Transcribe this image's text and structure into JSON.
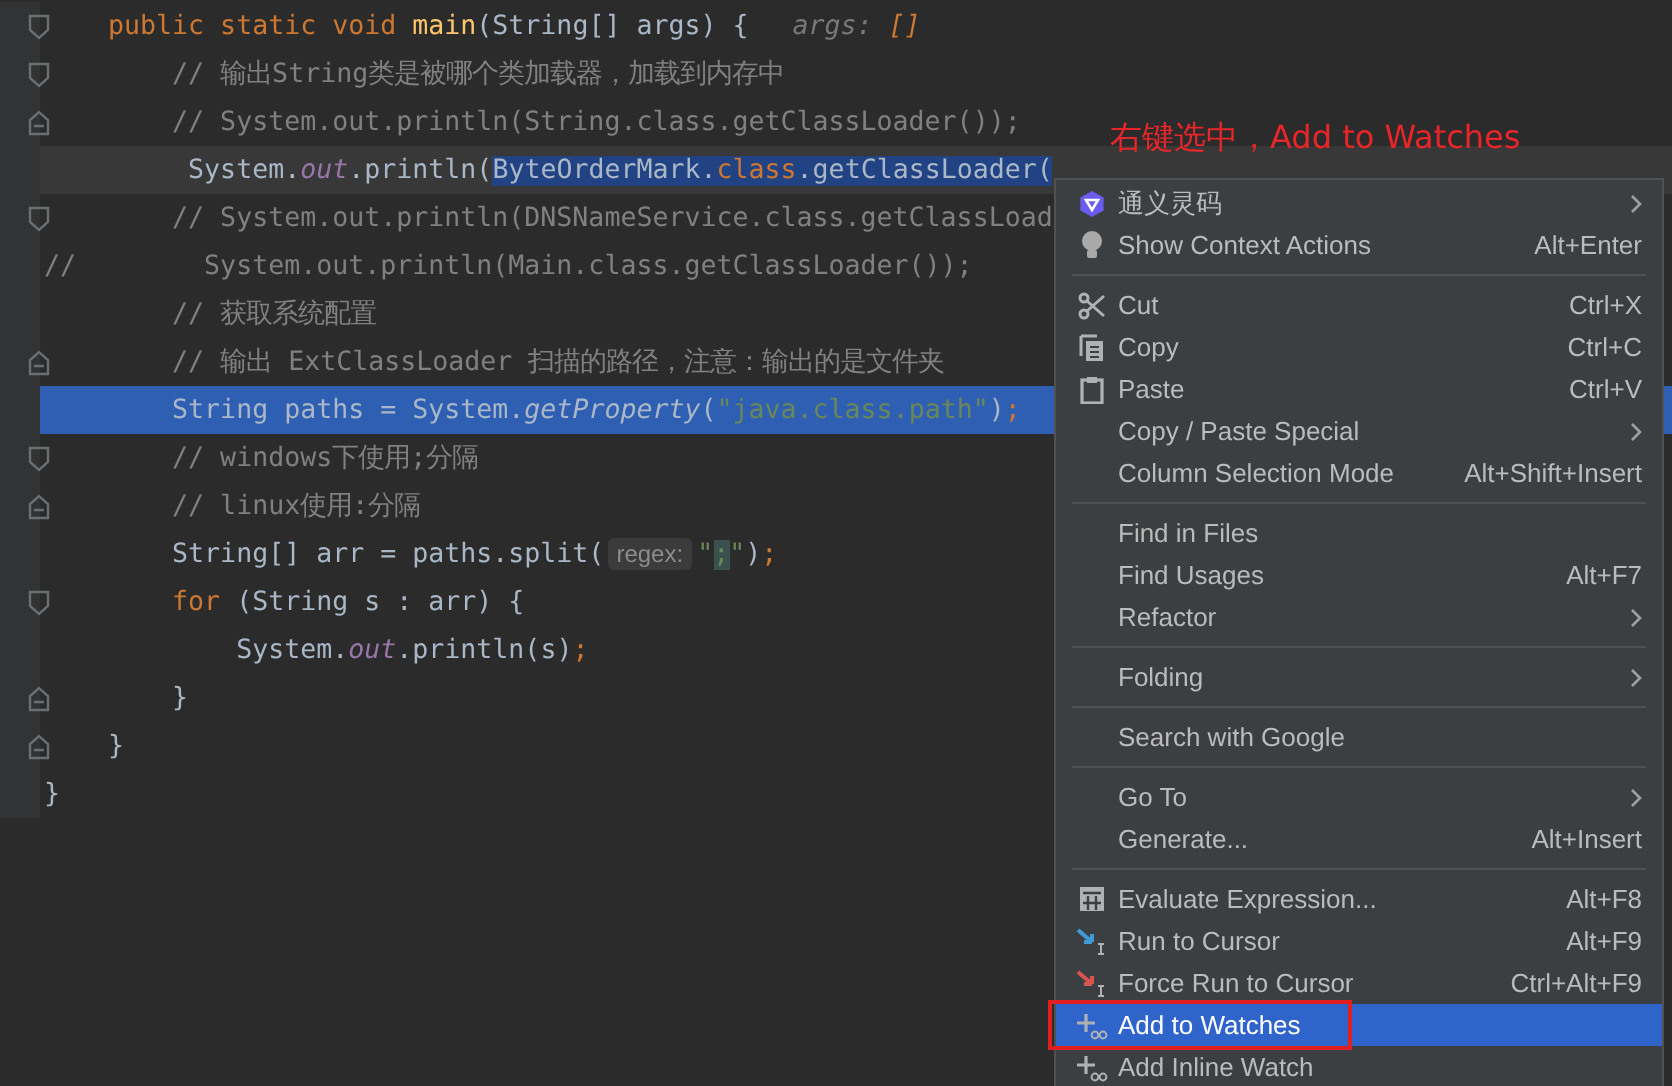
{
  "editor": {
    "lines": [
      {
        "fold_start": true,
        "fold_end": false,
        "current": false,
        "selected": false,
        "tokens": [
          {
            "t": "    public static void ",
            "kind": "kw"
          },
          {
            "t": "main",
            "kind": "decl"
          },
          {
            "t": "(String[] args) {",
            "kind": "plain"
          },
          {
            "t": "args: ",
            "kind": "debug-name"
          },
          {
            "t": "[]",
            "kind": "debug-value"
          }
        ]
      },
      {
        "fold_start": true,
        "fold_end": false,
        "current": false,
        "selected": false,
        "tokens": [
          {
            "t": "        // 输出String类是被哪个类加载器，加载到内存中",
            "kind": "comment"
          }
        ]
      },
      {
        "fold_start": false,
        "fold_end": true,
        "current": false,
        "selected": false,
        "tokens": [
          {
            "t": "        // System.out.println(String.class.getClassLoader());",
            "kind": "comment"
          }
        ]
      },
      {
        "fold_start": false,
        "fold_end": false,
        "current": true,
        "selected": false,
        "tokens": [
          {
            "t": "         System.",
            "kind": "plain"
          },
          {
            "t": "out",
            "kind": "field"
          },
          {
            "t": ".println(",
            "kind": "plain"
          },
          {
            "t": "ByteOrderMark.",
            "kind": "sel"
          },
          {
            "t": "class",
            "kind": "sel-kw"
          },
          {
            "t": ".getClassLoader(",
            "kind": "sel"
          }
        ]
      },
      {
        "fold_start": true,
        "fold_end": false,
        "current": false,
        "selected": false,
        "tokens": [
          {
            "t": "        // System.out.println(DNSNameService.class.getClassLoad",
            "kind": "comment"
          }
        ]
      },
      {
        "fold_start": false,
        "fold_end": false,
        "current": false,
        "selected": false,
        "tokens": [
          {
            "t": "//        System.out.println(Main.class.getClassLoader());",
            "kind": "comment"
          }
        ]
      },
      {
        "fold_start": false,
        "fold_end": false,
        "current": false,
        "selected": false,
        "tokens": [
          {
            "t": "        // 获取系统配置",
            "kind": "comment"
          }
        ]
      },
      {
        "fold_start": false,
        "fold_end": true,
        "current": false,
        "selected": false,
        "tokens": [
          {
            "t": "        // 输出 ExtClassLoader 扫描的路径，注意：输出的是文件夹",
            "kind": "comment"
          }
        ]
      },
      {
        "fold_start": false,
        "fold_end": false,
        "current": false,
        "selected": true,
        "tokens": [
          {
            "t": "        String paths = System.",
            "kind": "plain"
          },
          {
            "t": "getProperty",
            "kind": "method"
          },
          {
            "t": "(",
            "kind": "plain"
          },
          {
            "t": "\"java.class.path\"",
            "kind": "str"
          },
          {
            "t": ")",
            "kind": "plain"
          },
          {
            "t": ";",
            "kind": "punct"
          }
        ]
      },
      {
        "fold_start": true,
        "fold_end": false,
        "current": false,
        "selected": false,
        "tokens": [
          {
            "t": "        // windows下使用;分隔",
            "kind": "comment"
          }
        ]
      },
      {
        "fold_start": false,
        "fold_end": true,
        "current": false,
        "selected": false,
        "tokens": [
          {
            "t": "        // linux使用:分隔",
            "kind": "comment"
          }
        ]
      },
      {
        "fold_start": false,
        "fold_end": false,
        "current": false,
        "selected": false,
        "tokens": [
          {
            "t": "        String[] arr = paths.split(",
            "kind": "plain"
          },
          {
            "t": "regex:",
            "kind": "hint"
          },
          {
            "t": "\"",
            "kind": "str"
          },
          {
            "t": ";",
            "kind": "str-hl"
          },
          {
            "t": "\"",
            "kind": "str"
          },
          {
            "t": ")",
            "kind": "plain"
          },
          {
            "t": ";",
            "kind": "punct"
          }
        ]
      },
      {
        "fold_start": true,
        "fold_end": false,
        "current": false,
        "selected": false,
        "tokens": [
          {
            "t": "        for",
            "kind": "kw"
          },
          {
            "t": " (String s : arr) {",
            "kind": "plain"
          }
        ]
      },
      {
        "fold_start": false,
        "fold_end": false,
        "current": false,
        "selected": false,
        "tokens": [
          {
            "t": "            System.",
            "kind": "plain"
          },
          {
            "t": "out",
            "kind": "field"
          },
          {
            "t": ".println(s)",
            "kind": "plain"
          },
          {
            "t": ";",
            "kind": "punct"
          }
        ]
      },
      {
        "fold_start": false,
        "fold_end": true,
        "current": false,
        "selected": false,
        "tokens": [
          {
            "t": "        }",
            "kind": "plain"
          }
        ]
      },
      {
        "fold_start": false,
        "fold_end": true,
        "current": false,
        "selected": false,
        "tokens": [
          {
            "t": "    }",
            "kind": "plain"
          }
        ]
      },
      {
        "fold_start": false,
        "fold_end": false,
        "current": false,
        "selected": false,
        "tokens": [
          {
            "t": "}",
            "kind": "plain"
          }
        ]
      }
    ]
  },
  "annotation": {
    "text": "右键选中，Add to Watches"
  },
  "context_menu": {
    "items": [
      {
        "kind": "logo",
        "label": "通义灵码",
        "submenu": true,
        "selected": false,
        "boxed": false
      },
      {
        "kind": "bulb",
        "label": "Show Context Actions",
        "shortcut": "Alt+Enter",
        "submenu": false,
        "selected": false,
        "boxed": false
      },
      {
        "kind": "separator"
      },
      {
        "kind": "scissors",
        "label": "Cut",
        "shortcut": "Ctrl+X",
        "submenu": false,
        "selected": false,
        "boxed": false
      },
      {
        "kind": "copy",
        "label": "Copy",
        "shortcut": "Ctrl+C",
        "submenu": false,
        "selected": false,
        "boxed": false
      },
      {
        "kind": "paste",
        "label": "Paste",
        "shortcut": "Ctrl+V",
        "submenu": false,
        "selected": false,
        "boxed": false
      },
      {
        "kind": "plain",
        "label": "Copy / Paste Special",
        "submenu": true,
        "selected": false,
        "boxed": false
      },
      {
        "kind": "plain",
        "label": "Column Selection Mode",
        "shortcut": "Alt+Shift+Insert",
        "submenu": false,
        "selected": false,
        "boxed": false
      },
      {
        "kind": "separator"
      },
      {
        "kind": "plain",
        "label": "Find in Files",
        "submenu": false,
        "selected": false,
        "boxed": false
      },
      {
        "kind": "plain",
        "label": "Find Usages",
        "shortcut": "Alt+F7",
        "submenu": false,
        "selected": false,
        "boxed": false
      },
      {
        "kind": "plain",
        "label": "Refactor",
        "submenu": true,
        "selected": false,
        "boxed": false
      },
      {
        "kind": "separator"
      },
      {
        "kind": "plain",
        "label": "Folding",
        "submenu": true,
        "selected": false,
        "boxed": false
      },
      {
        "kind": "separator"
      },
      {
        "kind": "plain",
        "label": "Search with Google",
        "submenu": false,
        "selected": false,
        "boxed": false
      },
      {
        "kind": "separator"
      },
      {
        "kind": "plain",
        "label": "Go To",
        "submenu": true,
        "selected": false,
        "boxed": false
      },
      {
        "kind": "plain",
        "label": "Generate...",
        "shortcut": "Alt+Insert",
        "submenu": false,
        "selected": false,
        "boxed": false
      },
      {
        "kind": "separator"
      },
      {
        "kind": "calculator",
        "label": "Evaluate Expression...",
        "shortcut": "Alt+F8",
        "submenu": false,
        "selected": false,
        "boxed": false
      },
      {
        "kind": "run-cursor",
        "label": "Run to Cursor",
        "shortcut": "Alt+F9",
        "submenu": false,
        "selected": false,
        "boxed": false
      },
      {
        "kind": "force-run",
        "label": "Force Run to Cursor",
        "shortcut": "Ctrl+Alt+F9",
        "submenu": false,
        "selected": false,
        "boxed": false
      },
      {
        "kind": "watch",
        "label": "Add to Watches",
        "submenu": false,
        "selected": true,
        "boxed": true
      },
      {
        "kind": "watch",
        "label": "Add Inline Watch",
        "submenu": false,
        "selected": false,
        "boxed": false
      }
    ]
  }
}
